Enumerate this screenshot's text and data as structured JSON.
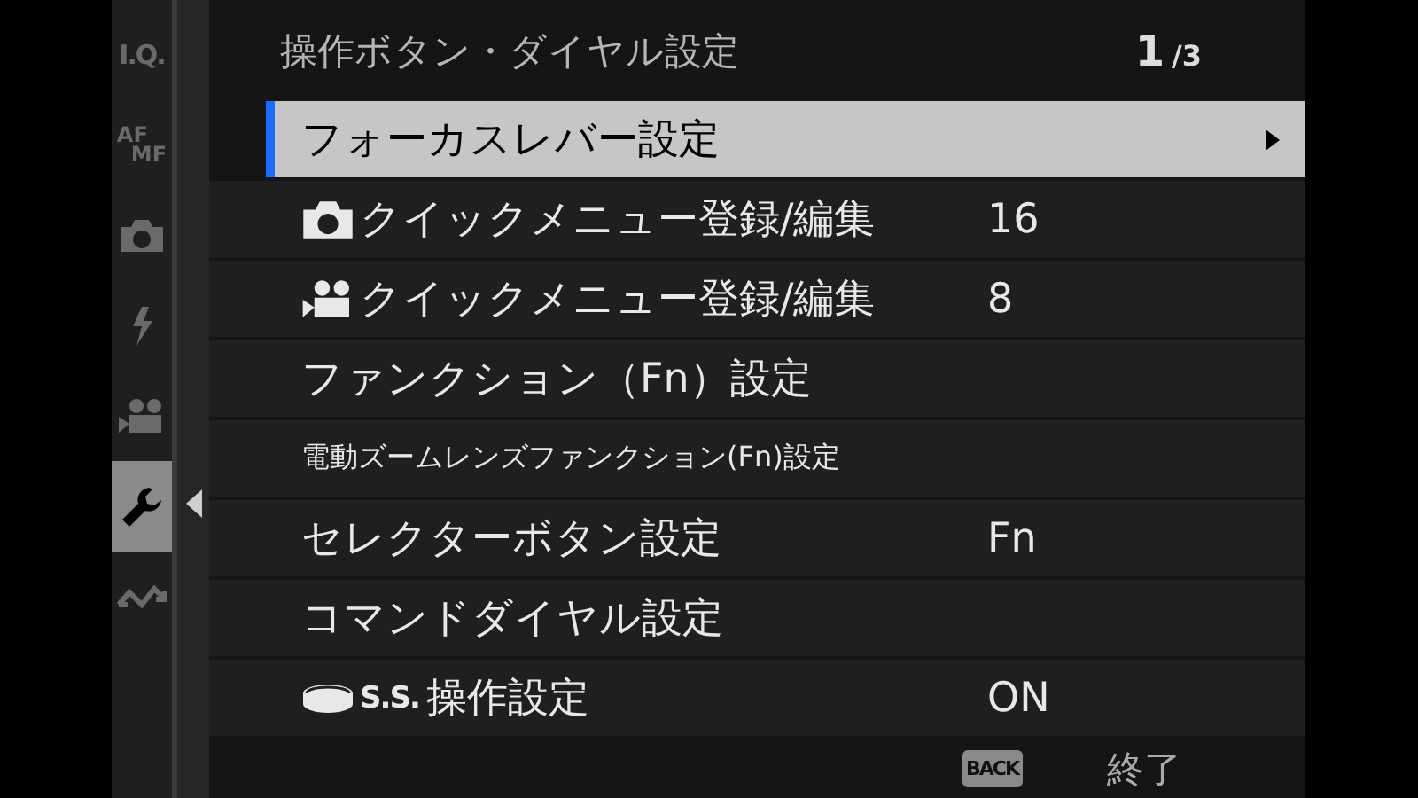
{
  "sidebar": {
    "items": [
      {
        "kind": "text",
        "label": "I.Q.",
        "selected": false
      },
      {
        "kind": "stack",
        "labels": [
          "AF",
          "MF"
        ],
        "selected": false
      },
      {
        "kind": "camera",
        "selected": false
      },
      {
        "kind": "flash",
        "selected": false
      },
      {
        "kind": "movie",
        "selected": false
      },
      {
        "kind": "wrench",
        "selected": true
      },
      {
        "kind": "connect",
        "selected": false
      }
    ]
  },
  "header": {
    "title": "操作ボタン・ダイヤル設定",
    "page": "1",
    "page_total": "/3"
  },
  "menu": {
    "items": [
      {
        "kind": "plain",
        "label": "フォーカスレバー設定",
        "selected": true,
        "submenu": true
      },
      {
        "kind": "camera",
        "label": "クイックメニュー登録/編集",
        "value": "16",
        "selected": false
      },
      {
        "kind": "movie",
        "label": "クイックメニュー登録/編集",
        "value": "8",
        "selected": false
      },
      {
        "kind": "plain",
        "label": "ファンクション（Fn）設定",
        "selected": false
      },
      {
        "kind": "plain",
        "label": "電動ズームレンズファンクション(Fn)設定",
        "compact": true,
        "selected": false
      },
      {
        "kind": "plain",
        "label": "セレクターボタン設定",
        "value": "Fn",
        "selected": false
      },
      {
        "kind": "plain",
        "label": "コマンドダイヤル設定",
        "selected": false
      },
      {
        "kind": "dial",
        "prefix": "S.S.",
        "label": "操作設定",
        "value": "ON",
        "selected": false
      }
    ]
  },
  "footer": {
    "button": "BACK",
    "action": "終了"
  }
}
